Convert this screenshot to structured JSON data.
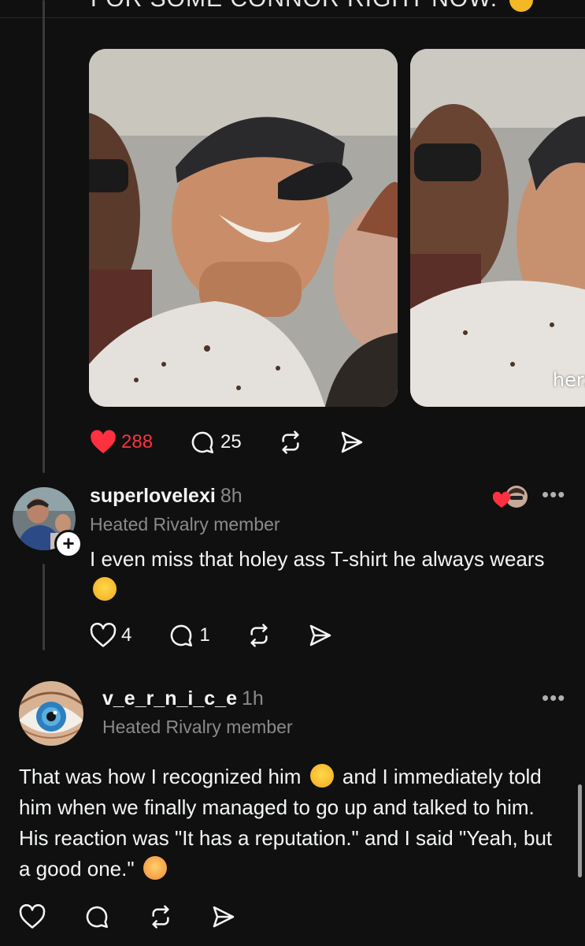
{
  "top_post": {
    "caption_cutoff": "FOR SOME CONNOR RIGHT NOW.",
    "watermark": "herzi",
    "likes": "288",
    "comments": "25"
  },
  "reply1": {
    "username": "superlovelexi",
    "time": "8h",
    "badge": "Heated Rivalry member",
    "text_part1": "I even miss that holey ass T-shirt he always wears",
    "emoji_name": "rolling-on-floor-laughing-emoji",
    "likes": "4",
    "comments": "1",
    "liked_by_author_icon": "heart-avatar-icon"
  },
  "reply2": {
    "username": "v_e_r_n_i_c_e",
    "time": "1h",
    "badge": "Heated Rivalry member",
    "text_part1": "That was how I recognized him",
    "emoji1_name": "grinning-sweat-emoji",
    "text_part2": "and I immediately told him when we finally managed to go up and talked to him. His reaction was \"It has a reputation.\" and I said \"Yeah, but a good one.\"",
    "emoji2_name": "smiling-hearts-emoji"
  },
  "icons": {
    "like": "heart-icon",
    "comment": "speech-bubble-icon",
    "repost": "repost-icon",
    "share": "paper-plane-icon",
    "more": "more-dots-icon"
  },
  "colors": {
    "background": "#101010",
    "text": "#f3f5f7",
    "muted": "#8a8a8a",
    "like_red": "#ff3040"
  }
}
